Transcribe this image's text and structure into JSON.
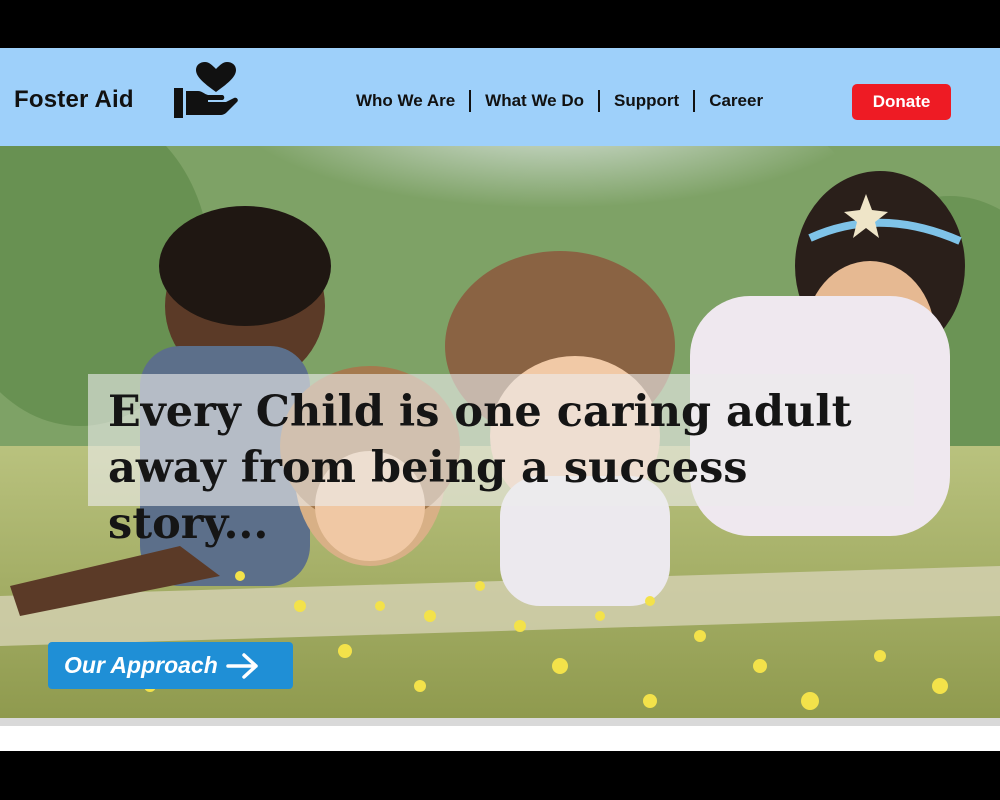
{
  "brand": {
    "name": "Foster Aid",
    "logo_icon": "heart-hand-icon"
  },
  "nav": {
    "items": [
      {
        "label": "Who We Are"
      },
      {
        "label": "What We Do"
      },
      {
        "label": "Support"
      },
      {
        "label": "Career"
      }
    ],
    "donate_label": "Donate"
  },
  "hero": {
    "headline_line1": "Every Child is one caring adult",
    "headline_line2": "away from being a success story...",
    "cta_label": "Our Approach",
    "cta_icon": "arrow-right-icon"
  },
  "colors": {
    "header_bg": "#9ed0fa",
    "donate_bg": "#ee1b24",
    "cta_bg": "#1f8fd6"
  }
}
